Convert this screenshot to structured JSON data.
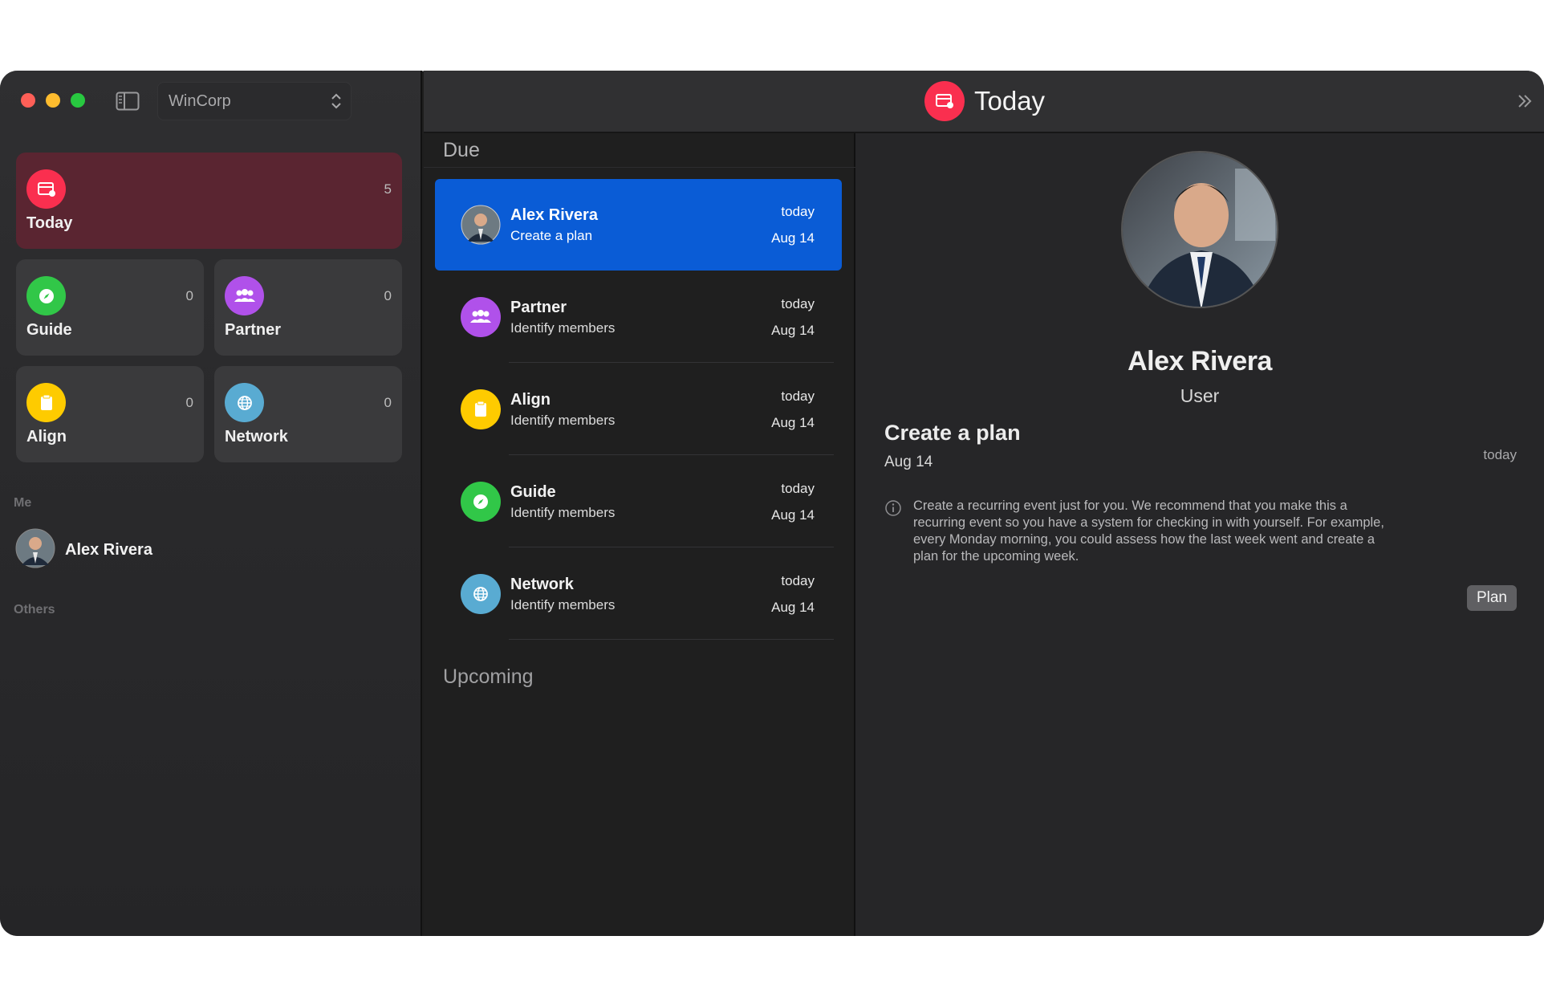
{
  "window": {
    "workspace": "WinCorp",
    "title": "Today"
  },
  "sidebar": {
    "tiles": [
      {
        "label": "Today",
        "count": "5",
        "color": "#fa2f4f",
        "icon": "calendar-icon"
      },
      {
        "label": "Guide",
        "count": "0",
        "color": "#31c748",
        "icon": "compass-icon"
      },
      {
        "label": "Partner",
        "count": "0",
        "color": "#b051ea",
        "icon": "group-icon"
      },
      {
        "label": "Align",
        "count": "0",
        "color": "#fecb00",
        "icon": "clipboard-icon"
      },
      {
        "label": "Network",
        "count": "0",
        "color": "#59abd2",
        "icon": "globe-icon"
      }
    ],
    "me_label": "Me",
    "me_name": "Alex Rivera",
    "others_label": "Others"
  },
  "list": {
    "due_header": "Due",
    "upcoming_header": "Upcoming",
    "rows": [
      {
        "name": "Alex Rivera",
        "subtitle": "Create a plan",
        "when": "today",
        "date": "Aug 14",
        "selected": true
      },
      {
        "name": "Partner",
        "subtitle": "Identify members",
        "when": "today",
        "date": "Aug 14"
      },
      {
        "name": "Align",
        "subtitle": "Identify members",
        "when": "today",
        "date": "Aug 14"
      },
      {
        "name": "Guide",
        "subtitle": "Identify members",
        "when": "today",
        "date": "Aug 14"
      },
      {
        "name": "Network",
        "subtitle": "Identify members",
        "when": "today",
        "date": "Aug 14"
      }
    ]
  },
  "detail": {
    "name": "Alex Rivera",
    "role": "User",
    "task": "Create a plan",
    "date": "Aug 14",
    "when": "today",
    "description": "Create a recurring event just for you. We recommend that you make this a recurring event so you have a system for checking in with yourself. For example, every Monday morning, you could assess how the last week went and create a plan for the upcoming week.",
    "button": "Plan"
  },
  "colors": {
    "accent": "#0a5cd6",
    "today_tile": "#5a2531"
  }
}
